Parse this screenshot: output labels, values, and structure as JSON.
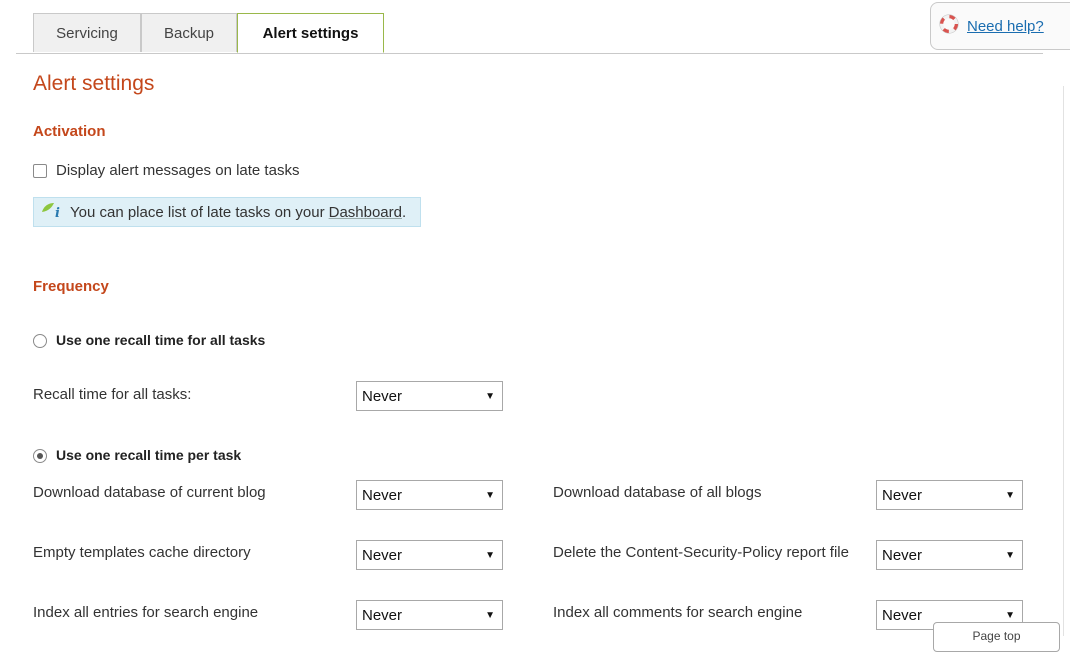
{
  "tabs": [
    {
      "label": "Servicing",
      "active": false
    },
    {
      "label": "Backup",
      "active": false
    },
    {
      "label": "Alert settings",
      "active": true
    }
  ],
  "help": {
    "label": "Need help?",
    "icon": "lifebuoy-icon"
  },
  "page_title": "Alert settings",
  "activation": {
    "heading": "Activation",
    "checkbox_label": "Display alert messages on late tasks",
    "checked": false,
    "info_text": "You can place list of late tasks on your",
    "info_link": "Dashboard",
    "info_suffix": "."
  },
  "frequency": {
    "heading": "Frequency",
    "option_all_label": "Use one recall time for all tasks",
    "option_all_selected": false,
    "recall_all_label": "Recall time for all tasks:",
    "recall_all_value": "Never",
    "option_per_task_label": "Use one recall time per task",
    "option_per_task_selected": true
  },
  "tasks": [
    {
      "label": "Download database of current blog",
      "value": "Never"
    },
    {
      "label": "Download database of all blogs",
      "value": "Never"
    },
    {
      "label": "Empty templates cache directory",
      "value": "Never"
    },
    {
      "label": "Delete the Content-Security-Policy report file",
      "value": "Never"
    },
    {
      "label": "Index all entries for search engine",
      "value": "Never"
    },
    {
      "label": "Index all comments for search engine",
      "value": "Never"
    }
  ],
  "page_top": {
    "label": "Page top"
  },
  "colors": {
    "accent": "#c4471b",
    "link": "#1a6db0",
    "active_tab_border": "#9ab84a",
    "info_bg": "#dff0f7"
  }
}
